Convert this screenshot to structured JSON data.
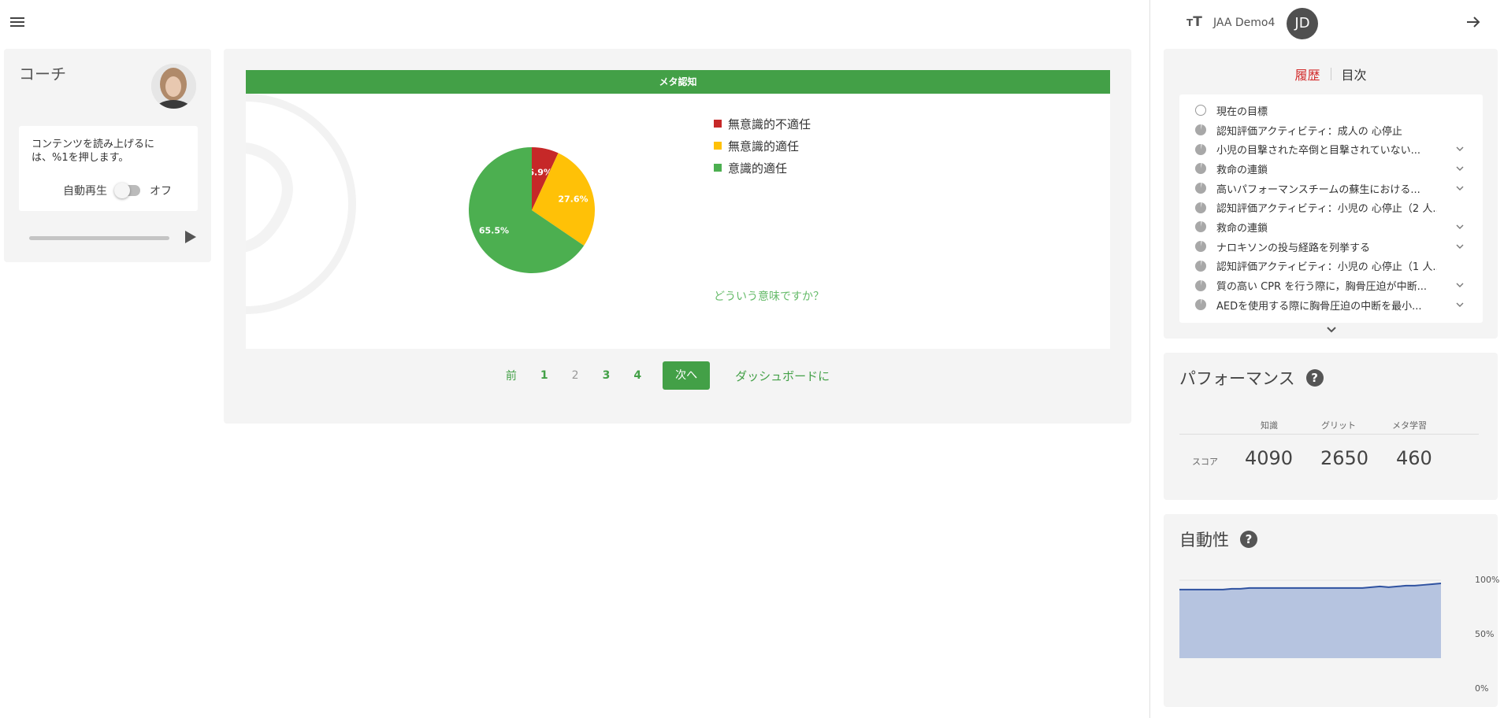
{
  "coach": {
    "title": "コーチ",
    "instruction": "コンテンツを読み上げるには、%1を押します。",
    "autoplay_label": "自動再生",
    "autoplay_state": "オフ",
    "autoplay_on": false,
    "audio_progress": 0
  },
  "main": {
    "chart_title": "メタ認知",
    "meaning_link": "どういう意味ですか？",
    "pagination": {
      "prev": "前",
      "pages": [
        "1",
        "2",
        "3",
        "4"
      ],
      "current_page": "2",
      "next": "次へ",
      "dashboard": "ダッシュボードに"
    }
  },
  "chart_data": {
    "type": "pie",
    "title": "メタ認知",
    "labels": [
      "無意識的不適任",
      "無意識的適任",
      "意識的適任"
    ],
    "values": [
      6.9,
      27.6,
      65.5
    ],
    "value_labels": [
      "6.9%",
      "27.6%",
      "65.5%"
    ],
    "colors": [
      "#c62828",
      "#ffc107",
      "#4caf50"
    ],
    "legend_position": "right"
  },
  "user": {
    "name": "JAA Demo4",
    "initials": "JD"
  },
  "history": {
    "tabs": [
      "履歴",
      "目次"
    ],
    "active_tab": "履歴",
    "items": [
      {
        "label": "現在の目標",
        "icon": "empty-circle-icon",
        "expandable": false
      },
      {
        "label": "認知評価アクティビティ：成人の 心停止",
        "icon": "progress-circle-icon",
        "expandable": false
      },
      {
        "label": "小児の目撃された卒倒と目撃されていない...",
        "icon": "progress-circle-icon",
        "expandable": true
      },
      {
        "label": "救命の連鎖",
        "icon": "progress-circle-icon",
        "expandable": true
      },
      {
        "label": "高いパフォーマンスチームの蘇生における...",
        "icon": "progress-circle-icon",
        "expandable": true
      },
      {
        "label": "認知評価アクティビティ：小児の 心停止（2 人...",
        "icon": "progress-circle-icon",
        "expandable": false
      },
      {
        "label": "救命の連鎖",
        "icon": "progress-circle-icon",
        "expandable": true
      },
      {
        "label": "ナロキソンの投与経路を列挙する",
        "icon": "progress-circle-icon",
        "expandable": true
      },
      {
        "label": "認知評価アクティビティ：小児の 心停止（1 人...",
        "icon": "progress-circle-icon",
        "expandable": false
      },
      {
        "label": "質の高い CPR を行う際に，胸骨圧迫が中断...",
        "icon": "progress-circle-icon",
        "expandable": true
      },
      {
        "label": "AEDを使用する際に胸骨圧迫の中断を最小...",
        "icon": "progress-circle-icon",
        "expandable": true
      }
    ]
  },
  "performance": {
    "title": "パフォーマンス",
    "columns": [
      "知識",
      "グリット",
      "メタ学習"
    ],
    "row_label": "スコア",
    "values": [
      "4090",
      "2650",
      "460"
    ]
  },
  "automaticity": {
    "title": "自動性",
    "yticks": [
      "100%",
      "50%",
      "0%"
    ],
    "series": [
      88,
      88,
      88,
      88,
      88,
      88,
      89,
      89,
      90,
      90,
      90,
      90,
      90,
      90,
      90,
      90,
      90,
      90,
      90,
      90,
      90,
      90,
      91,
      92,
      91,
      92,
      93,
      93,
      94,
      95,
      96
    ],
    "ylim": [
      0,
      100
    ],
    "colors": {
      "line": "#2f52a0",
      "fill": "#b6c4e0"
    }
  }
}
